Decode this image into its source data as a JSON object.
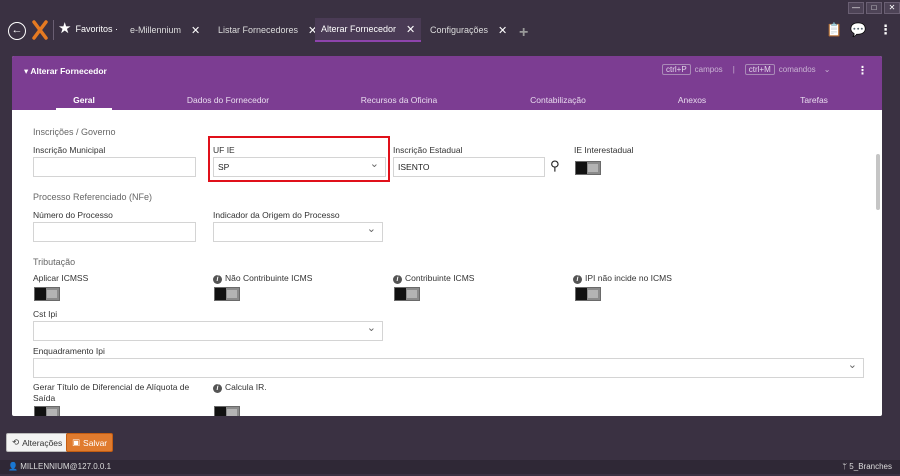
{
  "window": {
    "controls": [
      "—",
      "□",
      "✕"
    ]
  },
  "favorites": {
    "label": "Favoritos ·"
  },
  "tabs": [
    {
      "label": "e-Millennium"
    },
    {
      "label": "Listar Fornecedores"
    },
    {
      "label": "Alterar Fornecedor"
    },
    {
      "label": "Configurações"
    }
  ],
  "panel": {
    "title": "Alterar Fornecedor",
    "shortcut_fields_key": "ctrl+P",
    "shortcut_fields_label": "campos",
    "shortcut_sep": "|",
    "shortcut_cmds_key": "ctrl+M",
    "shortcut_cmds_label": "comandos",
    "subtabs": [
      "Geral",
      "Dados do Fornecedor",
      "Recursos da Oficina",
      "Contabilização",
      "Anexos",
      "Tarefas"
    ]
  },
  "form": {
    "sections": {
      "inscricoes": "Inscrições / Governo",
      "processo": "Processo Referenciado (NFe)",
      "tributacao": "Tributação"
    },
    "fields": {
      "inscricao_municipal": {
        "label": "Inscrição Municipal",
        "value": ""
      },
      "uf_ie": {
        "label": "UF IE",
        "value": "SP"
      },
      "inscricao_estadual": {
        "label": "Inscrição Estadual",
        "value": "ISENTO"
      },
      "ie_interestadual": {
        "label": "IE Interestadual"
      },
      "numero_processo": {
        "label": "Número do Processo",
        "value": ""
      },
      "indicador_origem": {
        "label": "Indicador da Origem do Processo",
        "value": ""
      },
      "aplicar_icmss": {
        "label": "Aplicar ICMSS"
      },
      "nao_contribuinte": {
        "label": "Não Contribuinte ICMS"
      },
      "contribuinte": {
        "label": "Contribuinte ICMS"
      },
      "ipi_nao_incide": {
        "label": "IPI não incide no ICMS"
      },
      "cst_ipi": {
        "label": "Cst Ipi",
        "value": ""
      },
      "enquadramento_ipi": {
        "label": "Enquadramento Ipi",
        "value": ""
      },
      "gerar_titulo": {
        "label_line1": "Gerar Título de Diferencial de Alíquota de",
        "label_line2": "Saída"
      },
      "calcula_ir": {
        "label": "Calcula IR."
      }
    }
  },
  "footer": {
    "alteracoes": "Alterações",
    "salvar": "Salvar"
  },
  "status": {
    "user": "MILLENNIUM@127.0.0.1",
    "branch": "5_Branches"
  }
}
